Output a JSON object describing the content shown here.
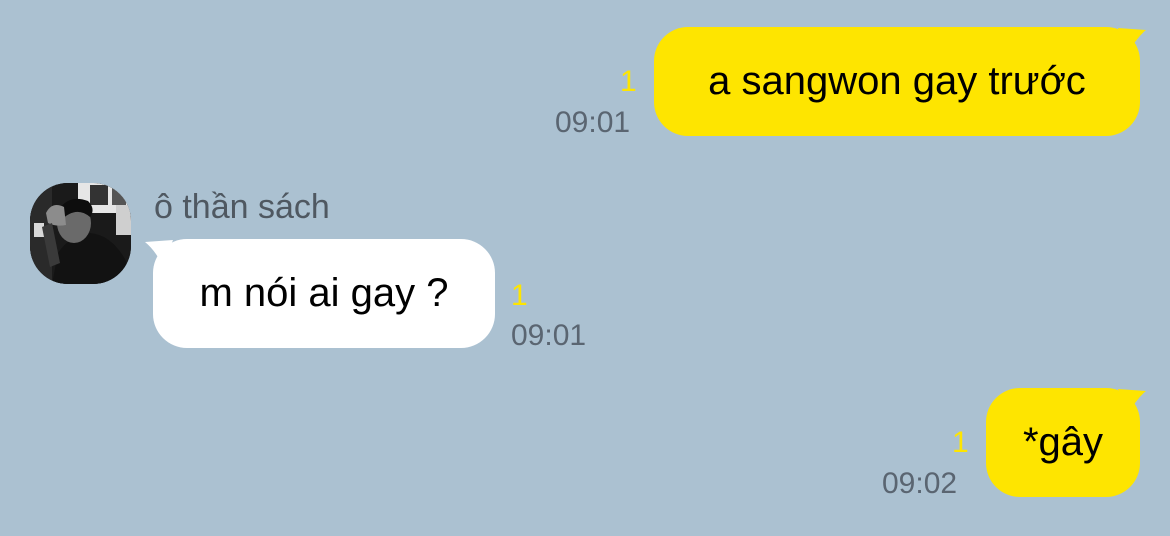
{
  "chat": {
    "messages": [
      {
        "direction": "outgoing",
        "text": "a sangwon gay trước",
        "unread": "1",
        "time": "09:01"
      },
      {
        "direction": "incoming",
        "sender": "ô thần sách",
        "text": "m nói ai gay ?",
        "unread": "1",
        "time": "09:01"
      },
      {
        "direction": "outgoing",
        "text": "*gây",
        "unread": "1",
        "time": "09:02"
      }
    ]
  },
  "colors": {
    "background": "#abc1d1",
    "outgoing_bubble": "#fee500",
    "incoming_bubble": "#ffffff",
    "unread_count": "#fee500",
    "timestamp": "#5a6571"
  },
  "icons": {
    "avatar": "user-profile-photo"
  }
}
